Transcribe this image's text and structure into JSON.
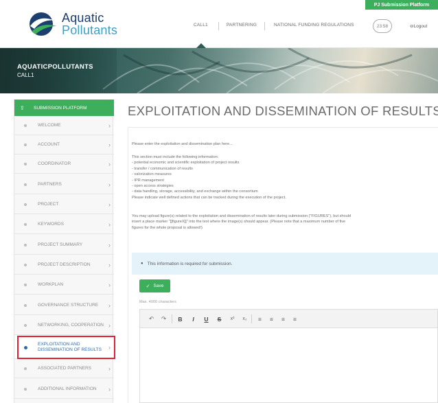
{
  "header": {
    "badge": "PJ Submission Platform",
    "logo_line1": "Aquatic",
    "logo_line2": "Pollutants",
    "nav": [
      {
        "label": "CALL1"
      },
      {
        "label": "PARTNERING"
      },
      {
        "label": "NATIONAL FUNDING REGULATIONS"
      }
    ],
    "timer": "23:58",
    "logout": "Logout"
  },
  "banner": {
    "title": "AQUATICPOLLUTANTS",
    "subtitle": "CALL1"
  },
  "sidebar": {
    "heading": "SUBMISSION PLATFORM",
    "items": [
      {
        "label": "WELCOME"
      },
      {
        "label": "ACCOUNT"
      },
      {
        "label": "COORDINATOR"
      },
      {
        "label": "PARTNERS"
      },
      {
        "label": "PROJECT"
      },
      {
        "label": "KEYWORDS"
      },
      {
        "label": "PROJECT SUMMARY"
      },
      {
        "label": "PROJECT DESCRIPTION"
      },
      {
        "label": "WORKPLAN"
      },
      {
        "label": "GOVERNANCE STRUCTURE"
      },
      {
        "label": "NETWORKING, COOPERATION"
      },
      {
        "label": "EXPLOITATION AND DISSEMINATION OF RESULTS",
        "line1": "EXPLOITATION AND",
        "line2": "DISSEMINATION OF RESULTS",
        "active": true
      },
      {
        "label": "ASSOCIATED PARTNERS"
      },
      {
        "label": "ADDITIONAL INFORMATION"
      }
    ]
  },
  "main": {
    "title": "EXPLOITATION AND DISSEMINATION OF RESULTS",
    "intro": "Please enter the exploitation and dissemination plan here...",
    "list_lines": [
      "This section must include the following information:",
      "- potential economic and scientific exploitation of project results",
      "- transfer / communication of results",
      "- valorization measures",
      "- IPR management",
      "- open access strategies",
      "- data handling, storage, accessibility, and exchange within the consortium",
      "Please indicate well defined actions that can be tracked during the execution of the project."
    ],
    "upload_lines": [
      "You may upload figure(s) related to the exploitation and dissemination of results later during submission (\"FIGURES\"), but should",
      "insert a place marker \"[[figureX]]\" into the text where the image(s) should appear. (Please note that a maximum number of five",
      "figures for the whole proposal is allowed!)"
    ],
    "info": "This information is required for submission.",
    "save_label": "Save",
    "max_chars": "Max. 4000 characters",
    "toolbar": [
      {
        "icon": "undo-icon",
        "glyph": "↶"
      },
      {
        "icon": "redo-icon",
        "glyph": "↷"
      },
      {
        "icon": "bold-icon",
        "glyph": "B"
      },
      {
        "icon": "italic-icon",
        "glyph": "I"
      },
      {
        "icon": "underline-icon",
        "glyph": "U"
      },
      {
        "icon": "strikethrough-icon",
        "glyph": "S"
      },
      {
        "icon": "superscript-icon",
        "glyph": "x²"
      },
      {
        "icon": "subscript-icon",
        "glyph": "x₂"
      },
      {
        "icon": "align-left-icon",
        "glyph": "≡"
      },
      {
        "icon": "align-center-icon",
        "glyph": "≡"
      },
      {
        "icon": "align-right-icon",
        "glyph": "≡"
      },
      {
        "icon": "justify-icon",
        "glyph": "≡"
      }
    ]
  },
  "colors": {
    "accent_green": "#3cae5c",
    "active_blue": "#2f6aa5",
    "highlight_red": "#e02032",
    "info_bg": "#e4f3fa"
  }
}
